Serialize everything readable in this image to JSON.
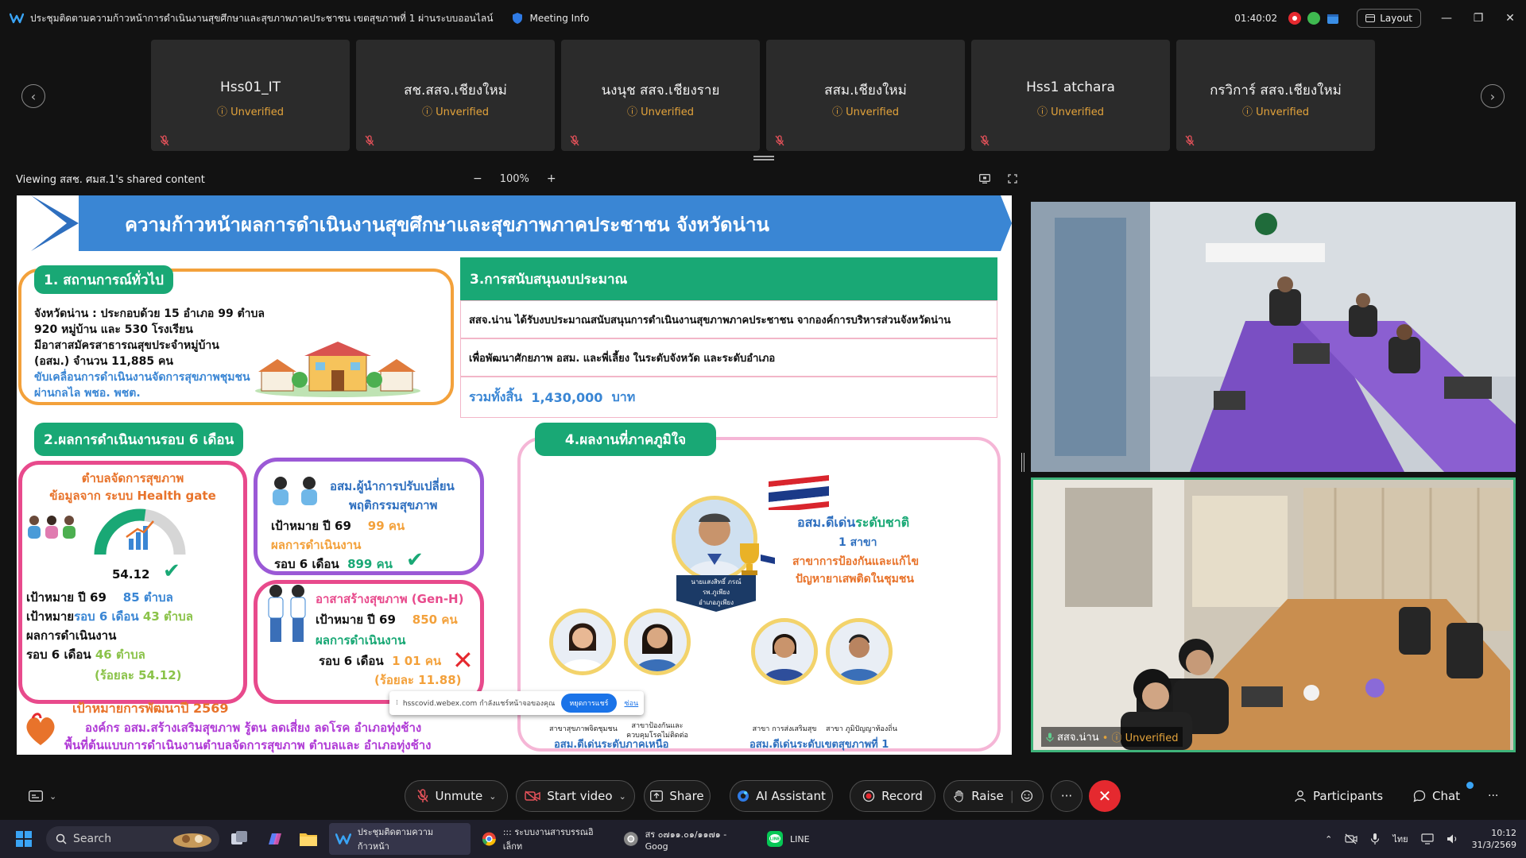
{
  "titlebar": {
    "meeting_title": "ประชุมติดตามความก้าวหน้าการดำเนินงานสุขศึกษาและสุขภาพภาคประชาชน เขตสุขภาพที่ 1 ผ่านระบบออนไลน์",
    "meeting_info": "Meeting Info",
    "timer": "01:40:02",
    "layout_label": "Layout"
  },
  "participants": [
    {
      "name": "Hss01_IT",
      "status": "Unverified"
    },
    {
      "name": "สช.สสจ.เชียงใหม่",
      "status": "Unverified"
    },
    {
      "name": "นงนุช สสจ.เชียงราย",
      "status": "Unverified"
    },
    {
      "name": "สสม.เชียงใหม่",
      "status": "Unverified"
    },
    {
      "name": "Hss1 atchara",
      "status": "Unverified"
    },
    {
      "name": "กรวิการ์ สสจ.เชียงใหม่",
      "status": "Unverified"
    }
  ],
  "sharebar": {
    "viewing": "Viewing สสช. ศมส.1's shared content",
    "zoom_minus": "−",
    "zoom_value": "100%",
    "zoom_plus": "+"
  },
  "slide": {
    "banner_title": "ความก้าวหน้าผลการดำเนินงานสุขศึกษาและสุขภาพภาคประชาชน จังหวัดน่าน",
    "s1_title": "1. สถานการณ์ทั่วไป",
    "s1_lines": [
      "จังหวัดน่าน : ประกอบด้วย 15  อำเภอ 99 ตำบล",
      "920 หมู่บ้าน และ 530 โรงเรียน",
      " มีอาสาสมัครสาธารณสุขประจำหมู่บ้าน",
      "(อสม.) จำนวน 11,885 คน"
    ],
    "s1_blue": [
      "ขับเคลื่อนการดำเนินงานจัดการสุขภาพชุมชน",
      "ผ่านกลไล พชอ. พชต."
    ],
    "s3_title": "3.การสนับสนุนงบประมาณ",
    "s3_row1": "สสจ.น่าน ได้รับงบประมาณสนับสนุนการดำเนินงานสุขภาพภาคประชาชน จากองค์การบริหารส่วนจังหวัดน่าน",
    "s3_row2": "เพื่อพัฒนาศักยภาพ อสม. และพี่เลี้ยง  ในระดับจังหวัด  และระดับอำเภอ",
    "s3_total_label": "รวมทั้งสิ้น",
    "s3_total_value": "1,430,000",
    "s3_total_unit": "บาท",
    "s2_title": "2.ผลการดำเนินงานรอบ 6 เดือน",
    "hg_title1": "ตำบลจัดการสุขภาพ",
    "hg_title2": "ข้อมูลจาก ระบบ Health gate",
    "hg_value": "54.12",
    "hg_gauge_percent": 54.12,
    "hg_target_label": "เป้าหมาย ปี 69",
    "hg_target_value": "85 ตำบล",
    "hg_round_label": "เป้าหมาย",
    "hg_round_blue": "รอบ 6 เดือน",
    "hg_round_value": "43  ตำบล",
    "hg_result_label": "ผลการดำเนินงาน",
    "hg_result_round": "รอบ 6 เดือน",
    "hg_result_value": "46 ตำบล",
    "hg_percent": "(ร้อยละ 54.12)",
    "osm_title1": "อสม.ผู้นำการปรับเปลี่ยน",
    "osm_title2": "พฤติกรรมสุขภาพ",
    "osm_target_label": "เป้าหมาย ปี 69",
    "osm_target_value": "99  คน",
    "osm_result_label": "ผลการดำเนินงาน",
    "osm_round_label": "รอบ 6 เดือน",
    "osm_round_value": "899  คน",
    "genh_title": "อาสาสร้างสุขภาพ (Gen-H)",
    "genh_target_label": "เป้าหมาย ปี 69",
    "genh_target_value": "850  คน",
    "genh_result_label": "ผลการดำเนินงาน",
    "genh_round_label": "รอบ 6 เดือน",
    "genh_round_value": "1 01 คน",
    "genh_percent": "(ร้อยละ  11.88)",
    "goal_title": "เป้าหมายการพัฒนาปี 2569",
    "goal_line1": "องค์กร อสม.สร้างเสริมสุขภาพ รู้ตน ลดเสี่ยง ลดโรค  อำเภอทุ่งช้าง",
    "goal_line2": "พื้นที่ต้นแบบการดำเนินงานตำบลจัดการสุขภาพ ตำบลและ อำเภอทุ่งช้าง",
    "s4_title": "4.ผลงานที่ภาคภูมิใจ",
    "nat_title_a": "อสม.ดีเด่น",
    "nat_title_b": "ระดับชาติ",
    "nat_count": "1    สาขา",
    "nat_branch1": "สาขาการป้องกันและแก้ไข",
    "nat_branch2": "ปัญหายาเสพติดในชุมชน",
    "main_person_name": "นายแสงสิทธิ์ ภรณ์",
    "main_person_place1": "รพ.ภูเพียง",
    "main_person_place2": "อำเภอภูเพียง",
    "north_label": "อสม.ดีเด่นระดับภาคเหนือ",
    "region_label": "อสม.ดีเด่นระดับเขตสุขภาพที่ 1",
    "cap_a": "สาขาสุขภาพจิตชุมชน",
    "cap_b1": "สาขาป้องกันและ",
    "cap_b2": "ควบคุมโรคไม่ติดต่อ",
    "cap_c": "สาขา การส่งเสริมสุข",
    "cap_d": "สาขา ภูมิปัญญาท้องถิ่น"
  },
  "toast": {
    "text": "hsscovid.webex.com กำลังแชร์หน้าจอของคุณ",
    "button": "หยุดการแชร์",
    "link": "ซ่อน"
  },
  "videos": {
    "room_label": "สสจ.น่าน",
    "room_status": "Unverified"
  },
  "controls": {
    "unmute": "Unmute",
    "start_video": "Start video",
    "share": "Share",
    "ai_assistant": "AI Assistant",
    "record": "Record",
    "raise": "Raise",
    "more": "···",
    "participants": "Participants",
    "chat": "Chat"
  },
  "taskbar": {
    "search": "Search",
    "app1": "ประชุมติดตามความก้าวหน้า",
    "app2": "::: ระบบงานสารบรรณอิเล็กท",
    "app3": "สร ๐๗๑๑.๐๑/๑๑๗๑ - Goog",
    "app4": "LINE",
    "lang": "ไทย",
    "time": "10:12",
    "date": "31/3/2569"
  },
  "colors": {
    "end_call": "#e5292f",
    "unverified": "#e3a33b",
    "slide_green": "#19a875",
    "slide_blue": "#4a90d9"
  }
}
